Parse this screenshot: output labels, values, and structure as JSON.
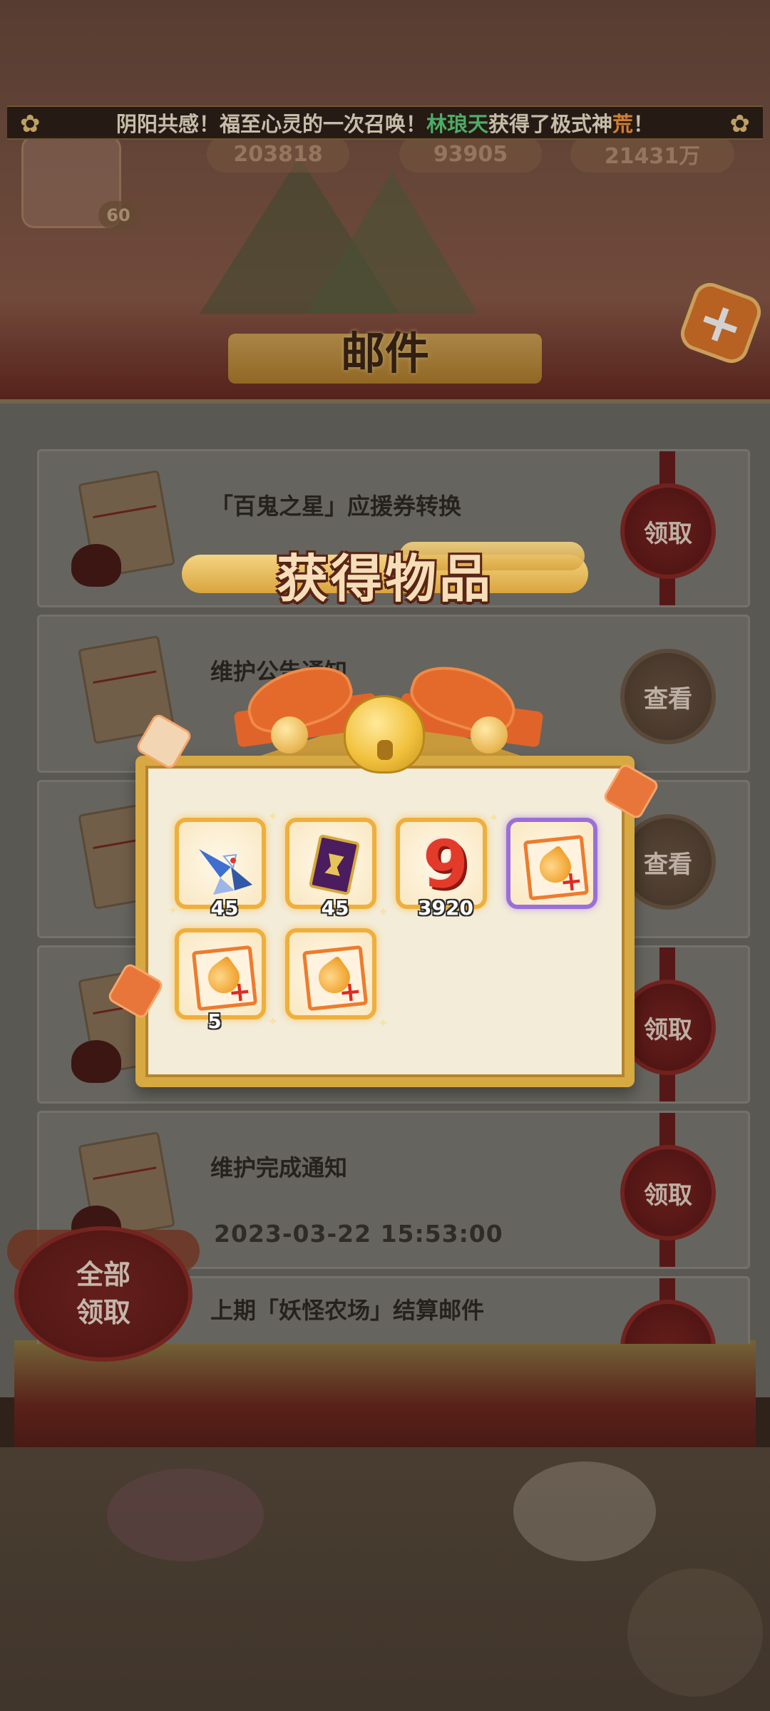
{
  "hud": {
    "level": "60",
    "stat1": "203818",
    "stat2": "93905",
    "stat3": "21431万"
  },
  "announcement": {
    "part1": "阴阳共感！福至心灵的一次召唤！",
    "player": "林琅天",
    "part2": "获得了极式神",
    "shikigami": "荒",
    "part3": "！"
  },
  "mail_window": {
    "title": "邮件",
    "close_icon": "close-x-icon",
    "claim_all_label_1": "全部",
    "claim_all_label_2": "领取",
    "items": [
      {
        "title": "「百鬼之星」应援券转换",
        "date": "",
        "action": "领取"
      },
      {
        "title": "维护公告通知",
        "date": "",
        "action": "查看"
      },
      {
        "title": "",
        "date": "",
        "action": "查看"
      },
      {
        "title": "",
        "date": "",
        "action": "领取"
      },
      {
        "title": "维护完成通知",
        "date": "2023-03-22 15:53:00",
        "action": "领取"
      },
      {
        "title": "上期「妖怪农场」结算邮件",
        "date": "",
        "action": ""
      }
    ]
  },
  "reward_popup": {
    "title": "获得物品",
    "items": [
      {
        "icon": "paper-crane-icon",
        "count": "45",
        "rarity": "gold"
      },
      {
        "icon": "purple-talisman-icon",
        "count": "45",
        "rarity": "gold"
      },
      {
        "icon": "gouyu-nine-icon",
        "count": "3920",
        "rarity": "gold"
      },
      {
        "icon": "exp-card-icon",
        "count": "",
        "rarity": "purple"
      },
      {
        "icon": "exp-card-icon",
        "count": "5",
        "rarity": "gold"
      },
      {
        "icon": "exp-card-icon",
        "count": "",
        "rarity": "gold"
      }
    ]
  },
  "colors": {
    "accent_gold": "#d7a943",
    "ribbon_orange": "#e46a2c",
    "knot_red": "#6a1e1c",
    "highlight_green": "#5fd27c",
    "highlight_orange": "#ff9a3a"
  }
}
